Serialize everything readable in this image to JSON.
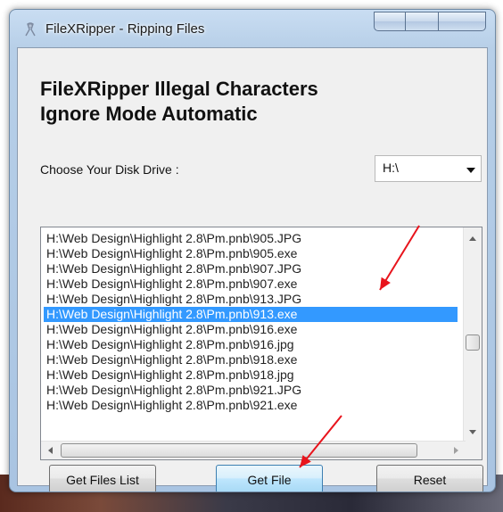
{
  "window": {
    "title": "FileXRipper - Ripping Files"
  },
  "main": {
    "heading_line1": "FileXRipper Illegal Characters",
    "heading_line2": "Ignore Mode Automatic",
    "drive_label": "Choose Your Disk Drive :",
    "drive_value": "H:\\"
  },
  "file_list": {
    "rows": [
      "H:\\Web Design\\Highlight 2.8\\Pm.pnb\\905.JPG",
      "H:\\Web Design\\Highlight 2.8\\Pm.pnb\\905.exe",
      "H:\\Web Design\\Highlight 2.8\\Pm.pnb\\907.JPG",
      "H:\\Web Design\\Highlight 2.8\\Pm.pnb\\907.exe",
      "H:\\Web Design\\Highlight 2.8\\Pm.pnb\\913.JPG",
      "H:\\Web Design\\Highlight 2.8\\Pm.pnb\\913.exe",
      "H:\\Web Design\\Highlight 2.8\\Pm.pnb\\916.exe",
      "H:\\Web Design\\Highlight 2.8\\Pm.pnb\\916.jpg",
      "H:\\Web Design\\Highlight 2.8\\Pm.pnb\\918.exe",
      "H:\\Web Design\\Highlight 2.8\\Pm.pnb\\918.jpg",
      "H:\\Web Design\\Highlight 2.8\\Pm.pnb\\921.JPG",
      "H:\\Web Design\\Highlight 2.8\\Pm.pnb\\921.exe"
    ],
    "selected_index": 5
  },
  "buttons": {
    "get_files_list": "Get Files List",
    "get_file": "Get File",
    "reset": "Reset"
  },
  "colors": {
    "selection": "#3399ff",
    "annotation_arrow": "#e8141c"
  }
}
